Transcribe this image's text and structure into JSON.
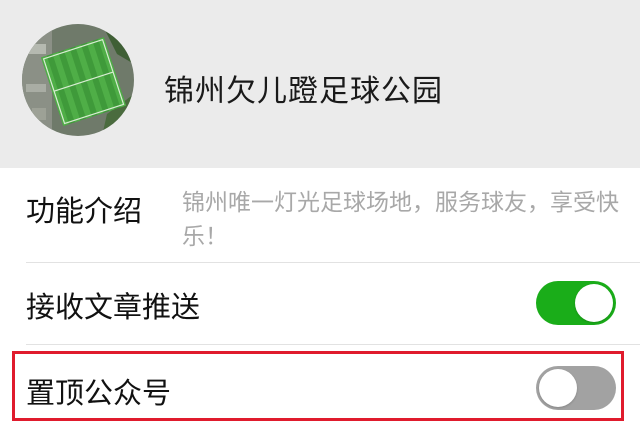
{
  "account": {
    "name": "锦州欠儿蹬足球公园",
    "avatar": "football-field-aerial-photo"
  },
  "intro": {
    "label": "功能介绍",
    "text": "锦州唯一灯光足球场地，服务球友，享受快乐！"
  },
  "receive_articles": {
    "label": "接收文章推送",
    "enabled": true
  },
  "pin_account": {
    "label": "置顶公众号",
    "enabled": false
  },
  "colors": {
    "toggle_on": "#1aad19",
    "toggle_off": "#a2a2a2",
    "highlight_border": "#e01b2d",
    "header_bg": "#ebebeb"
  }
}
